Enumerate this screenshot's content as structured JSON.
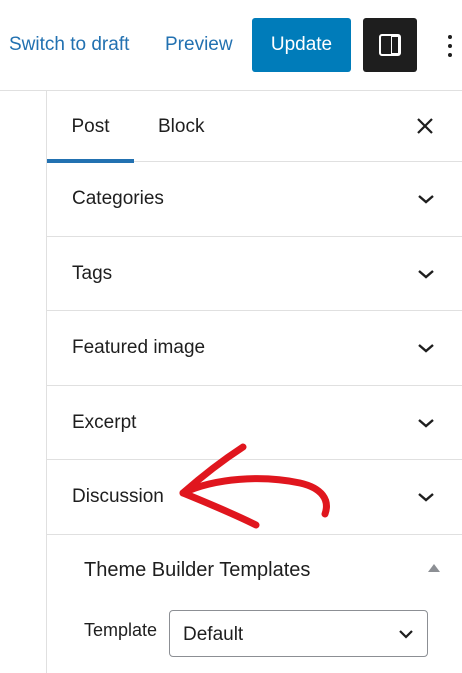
{
  "toolbar": {
    "switch_draft_label": "Switch to draft",
    "preview_label": "Preview",
    "update_label": "Update",
    "settings_icon": "sidebar-toggle-icon",
    "more_icon": "vertical-ellipsis-icon"
  },
  "sidebar": {
    "tabs": [
      {
        "label": "Post",
        "active": true
      },
      {
        "label": "Block",
        "active": false
      }
    ],
    "close_icon": "close-icon",
    "panels": [
      {
        "title": "Categories",
        "expanded": false
      },
      {
        "title": "Tags",
        "expanded": false
      },
      {
        "title": "Featured image",
        "expanded": false
      },
      {
        "title": "Excerpt",
        "expanded": false
      },
      {
        "title": "Discussion",
        "expanded": false
      }
    ],
    "theme_builder": {
      "title": "Theme Builder Templates",
      "expanded": true,
      "template_label": "Template",
      "template_value": "Default"
    }
  },
  "colors": {
    "accent": "#2271b1",
    "update_button": "#007cba",
    "annotation_arrow": "#e0161e"
  }
}
